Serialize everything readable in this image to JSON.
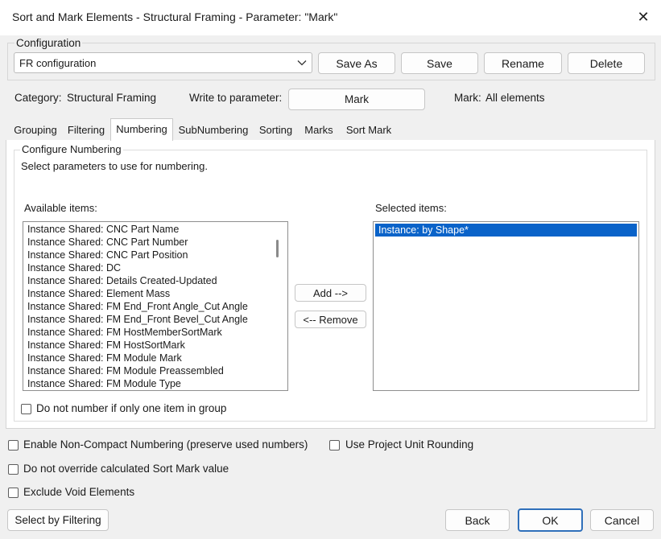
{
  "window": {
    "title": "Sort and Mark Elements - Structural Framing - Parameter: \"Mark\"",
    "close_glyph": "✕"
  },
  "configuration": {
    "group_label": "Configuration",
    "selected": "FR configuration",
    "save_as": "Save As",
    "save": "Save",
    "rename": "Rename",
    "delete": "Delete"
  },
  "info": {
    "category_label": "Category:",
    "category_value": "Structural Framing",
    "write_label": "Write to parameter:",
    "write_value": "Mark",
    "mark_label": "Mark:",
    "mark_value": "All elements"
  },
  "tabs": [
    {
      "label": "Grouping"
    },
    {
      "label": "Filtering"
    },
    {
      "label": "Numbering"
    },
    {
      "label": "SubNumbering"
    },
    {
      "label": "Sorting"
    },
    {
      "label": "Marks"
    },
    {
      "label": "Sort Mark"
    }
  ],
  "numbering": {
    "group_label": "Configure Numbering",
    "description": "Select parameters to use for numbering.",
    "available_label": "Available items:",
    "selected_label": "Selected items:",
    "available_items": [
      "Instance Shared: CNC Part Name",
      "Instance Shared: CNC Part Number",
      "Instance Shared: CNC Part Position",
      "Instance Shared: DC",
      "Instance Shared: Details Created-Updated",
      "Instance Shared: Element Mass",
      "Instance Shared: FM End_Front Angle_Cut Angle",
      "Instance Shared: FM End_Front Bevel_Cut Angle",
      "Instance Shared: FM HostMemberSortMark",
      "Instance Shared: FM HostSortMark",
      "Instance Shared: FM Module Mark",
      "Instance Shared: FM Module Preassembled",
      "Instance Shared: FM Module Type"
    ],
    "selected_items": [
      "Instance: by Shape*"
    ],
    "add": "Add -->",
    "remove": "<-- Remove",
    "single_item_option": "Do not number if only one item in group"
  },
  "options": {
    "non_compact": "Enable Non-Compact Numbering (preserve used numbers)",
    "unit_rounding": "Use Project Unit Rounding",
    "no_override": "Do not override calculated Sort Mark value",
    "exclude_void": "Exclude Void Elements"
  },
  "footer": {
    "select_by_filtering": "Select by Filtering",
    "back": "Back",
    "ok": "OK",
    "cancel": "Cancel"
  },
  "colors": {
    "selection": "#0a63c9",
    "dialog_bg": "#f0f0f0",
    "ok_border": "#2f6fba"
  }
}
